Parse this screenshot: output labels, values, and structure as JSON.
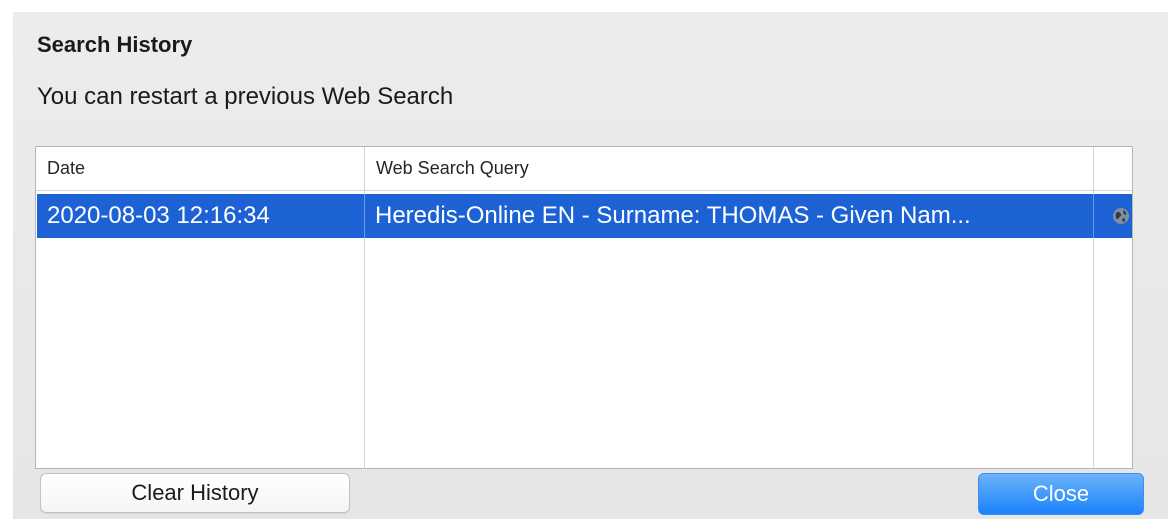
{
  "dialog": {
    "title": "Search History",
    "subtitle": "You can restart a previous Web Search"
  },
  "table": {
    "columns": [
      "Date",
      "Web Search Query"
    ],
    "rows": [
      {
        "date": "2020-08-03 12:16:34",
        "query": "Heredis-Online EN - Surname: THOMAS - Given Nam...",
        "icon": "globe-icon",
        "selected": true
      }
    ]
  },
  "buttons": {
    "clear_label": "Clear History",
    "close_label": "Close"
  },
  "colors": {
    "selection": "#1c62d5",
    "primary_button": "#1a82fb"
  }
}
